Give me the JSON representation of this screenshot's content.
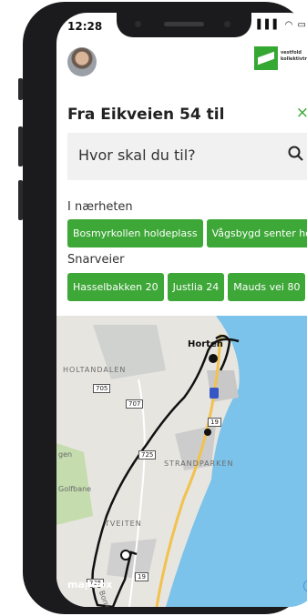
{
  "status": {
    "time": "12:28",
    "icons": "▌▌▌ ◠ ▭"
  },
  "header": {
    "logo_text_line1": "vestfold",
    "logo_text_line2": "kollektivtrafikk",
    "accent": "#35a833"
  },
  "destination": {
    "title": "Fra Eikveien 54 til",
    "close_label": "×"
  },
  "search": {
    "placeholder": "Hvor skal du til?"
  },
  "nearby": {
    "heading": "I nærheten",
    "items": [
      "Bosmyrkollen holdeplass",
      "Vågsbygd senter hol"
    ]
  },
  "shortcuts": {
    "heading": "Snarveier",
    "items": [
      "Hasselbakken 20",
      "Justlia 24",
      "Mauds vei 80"
    ]
  },
  "map": {
    "labels": {
      "town": "Horten",
      "holtandalen": "HOLTANDALEN",
      "strandparken": "STRANDPARKEN",
      "tveiten": "TVEITEN",
      "golfbane": "Golfbane",
      "gen": "gen",
      "borre": "Borre"
    },
    "road_numbers": [
      "705",
      "707",
      "725",
      "19",
      "19",
      "725",
      "19"
    ],
    "attribution": "mapbox",
    "info_label": "i"
  }
}
